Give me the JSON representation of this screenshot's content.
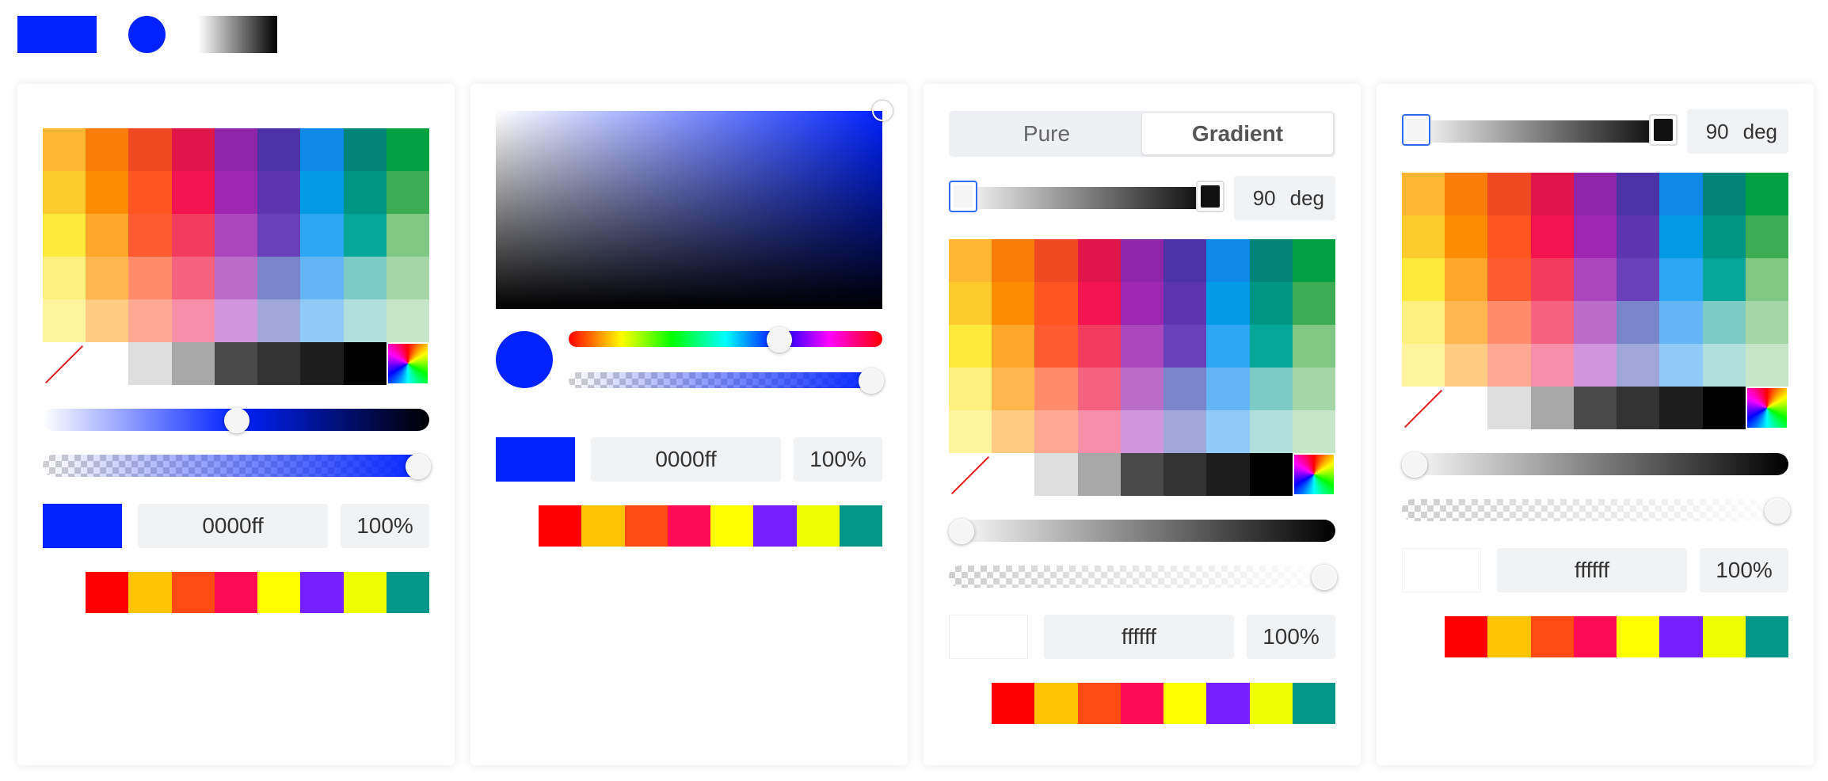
{
  "preview_row": {
    "rect_color": "#0022ff",
    "circle_color": "#0022ff",
    "gradient": [
      "#ffffff",
      "#000000"
    ]
  },
  "palette": [
    [
      "#fdb732",
      "#fb7d09",
      "#ef4a21",
      "#e0164a",
      "#8f26a9",
      "#4b32a7",
      "#0e89e7",
      "#038478",
      "#00a043"
    ],
    [
      "#fecb2f",
      "#fe8c01",
      "#fe5521",
      "#f2134f",
      "#9e27b1",
      "#5e35b1",
      "#039ae5",
      "#019586",
      "#3eac52"
    ],
    [
      "#feea3b",
      "#fea72a",
      "#fe5b31",
      "#f23c5f",
      "#ac46bd",
      "#6940b9",
      "#2da6f4",
      "#06a79a",
      "#81c784"
    ],
    [
      "#fdf07e",
      "#ffb64e",
      "#ff8b6a",
      "#f46280",
      "#b96dc9",
      "#7885cb",
      "#63b5f6",
      "#7dcbc5",
      "#a5d6a7"
    ],
    [
      "#fef49e",
      "#ffcc81",
      "#ffa992",
      "#f98eab",
      "#d095dc",
      "#9fa7d9",
      "#8fcaf9",
      "#b1dfdc",
      "#c7e6c8"
    ],
    [
      "none",
      "#ffffff",
      "#dedede",
      "#a8a8a8",
      "#4a4a4a",
      "#333333",
      "#1d1d1d",
      "#000000",
      "rainbow"
    ]
  ],
  "presets": [
    "#ffffff",
    "#ff0000",
    "#ffc502",
    "#ff4a12",
    "#ff0a54",
    "#ffff00",
    "#7620ff",
    "#eeff00",
    "#009688"
  ],
  "panel1": {
    "hex": "0000ff",
    "alpha": "100%",
    "color": "#0022ff",
    "lightness_level": 0.5,
    "alpha_level": 1.0
  },
  "panel2": {
    "hex": "0000ff",
    "alpha": "100%",
    "color": "#0022ff",
    "hue_level": 0.67,
    "alpha_level": 1.0
  },
  "panel3": {
    "tabs": [
      "Pure",
      "Gradient"
    ],
    "active_tab": "Gradient",
    "angle": "90",
    "angle_unit": "deg",
    "hex": "ffffff",
    "alpha": "100%",
    "color": "#ffffff",
    "lightness_level": 0.0,
    "alpha_level": 1.0
  },
  "panel4": {
    "angle": "90",
    "angle_unit": "deg",
    "hex": "ffffff",
    "alpha": "100%",
    "color": "#ffffff",
    "lightness_level": 0.0,
    "alpha_level": 1.0
  }
}
